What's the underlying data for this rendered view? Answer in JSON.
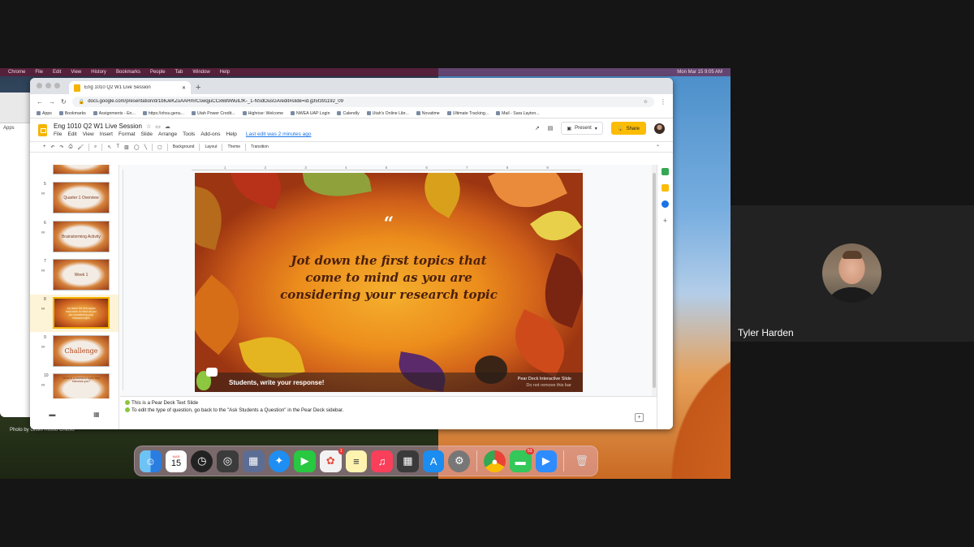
{
  "menubar": {
    "items": [
      "Chrome",
      "File",
      "Edit",
      "View",
      "History",
      "Bookmarks",
      "People",
      "Tab",
      "Window",
      "Help"
    ],
    "clock": "Mon Mar 15  9:05 AM"
  },
  "background_window": {
    "apps_label": "Apps"
  },
  "photo_credit": "Photo by Giulio Rosso Chioso",
  "browser": {
    "tab_title": "Eng 1010 Q2 W1 Live Session",
    "new_tab": "+",
    "url": "docs.google.com/presentation/d/1b6JeKZuAAHmrCswqjuCCx6B9WulLfK-_1-NSdOusGA/edit#slide=id.g35f391192_09",
    "bookmarks": [
      "Apps",
      "Bookmarks",
      "Assignments - En...",
      "https://ohsu.genu...",
      "Utah Power Credit...",
      "Highrise: Welcome",
      "NWEA UAP Login",
      "Calendly",
      "Utah's Online Libr...",
      "Novatime",
      "Ultimate Tracking...",
      "Mail - Sara Layton..."
    ]
  },
  "slides_app": {
    "doc_title": "Eng 1010 Q2 W1 Live Session",
    "menus": [
      "File",
      "Edit",
      "View",
      "Insert",
      "Format",
      "Slide",
      "Arrange",
      "Tools",
      "Add-ons",
      "Help"
    ],
    "last_edit": "Last edit was 2 minutes ago",
    "present_label": "Present",
    "share_label": "Share",
    "toolbar_text": [
      "Background",
      "Layout",
      "Theme",
      "Transition"
    ],
    "ruler_ticks": [
      "1",
      "2",
      "3",
      "4",
      "5",
      "6",
      "7",
      "8",
      "9"
    ]
  },
  "filmstrip": {
    "slides": [
      {
        "num": "",
        "text": ""
      },
      {
        "num": "5",
        "text": "Quarter 1 Overview"
      },
      {
        "num": "6",
        "text": "Brainstorming Activity"
      },
      {
        "num": "7",
        "text": "Week 1"
      },
      {
        "num": "8",
        "text": "Jot down the first topics that come to mind as you are considering your research topic"
      },
      {
        "num": "9",
        "text": "Challenge"
      },
      {
        "num": "10",
        "text": "What is a research topic that interests you?"
      },
      {
        "num": "11",
        "text": ""
      }
    ],
    "selected_index": 4
  },
  "slide": {
    "quote_mark": "“",
    "prompt": "Jot down the first topics that come to mind as you are considering your research topic",
    "peardeck_bar_text": "Students, write your response!",
    "peardeck_label": "Pear Deck Interactive Slide",
    "peardeck_sub": "Do not remove this bar"
  },
  "notes": {
    "line1": "This is a Pear Deck Text Slide",
    "line2": "To edit the type of question, go back to the \"Ask Students a Question\" in the Pear Deck sidebar."
  },
  "dock": {
    "calendar_month": "MAR",
    "calendar_day": "15",
    "photos_badge": "1",
    "messages_badge": "53"
  },
  "participant": {
    "name": "Tyler Harden"
  },
  "colors": {
    "accent_yellow": "#fbbc04",
    "peardeck_green": "#8dc63f",
    "slide_orange": "#ec8d1c",
    "link_blue": "#1a73e8"
  }
}
